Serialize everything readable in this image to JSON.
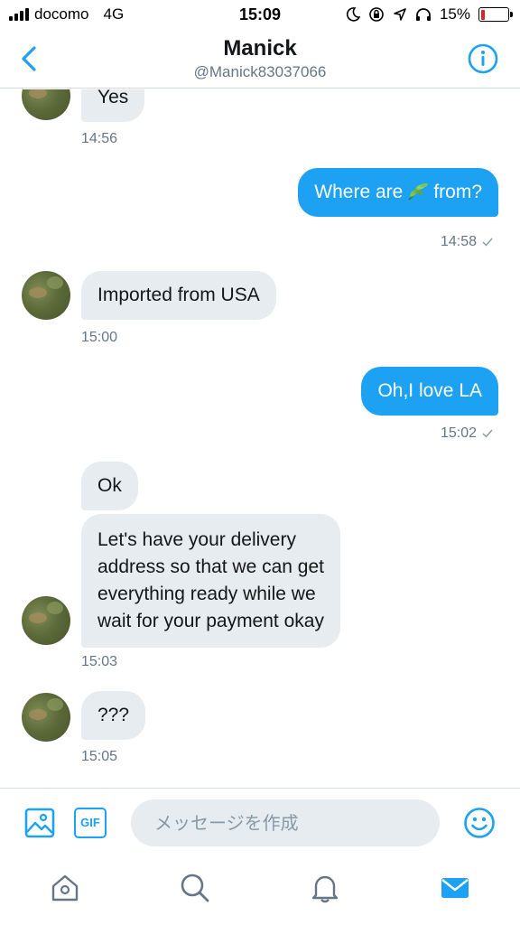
{
  "status_bar": {
    "carrier": "docomo",
    "network": "4G",
    "time": "15:09",
    "battery": "15%",
    "battery_level": 0.15
  },
  "header": {
    "name": "Manick",
    "handle": "@Manick83037066"
  },
  "messages": [
    {
      "side": "in",
      "text": "Yes",
      "time": "14:56"
    },
    {
      "side": "out",
      "text_before": "Where are",
      "icon": "leaf-emoji",
      "text_after": "from?",
      "time": "14:58"
    },
    {
      "side": "in",
      "text": "Imported from USA",
      "time": "15:00"
    },
    {
      "side": "out",
      "text": "Oh,I love LA",
      "time": "15:02"
    },
    {
      "side": "in",
      "text": "Ok"
    },
    {
      "side": "in",
      "lines": [
        "Let's have your delivery",
        "address so that we can get",
        "everything ready while we",
        "wait for your payment okay"
      ],
      "time": "15:03"
    },
    {
      "side": "in",
      "text": "???",
      "time": "15:05"
    }
  ],
  "composer": {
    "gif_label": "GIF",
    "placeholder": "メッセージを作成"
  },
  "colors": {
    "accent": "#1da1f2",
    "incoming_bubble": "#e6ecf0",
    "muted_text": "#657786"
  },
  "icons": [
    "chevron-left-icon",
    "info-icon",
    "image-icon",
    "emoji-icon",
    "home-icon",
    "search-icon",
    "bell-icon",
    "mail-icon",
    "checkmark-icon"
  ]
}
